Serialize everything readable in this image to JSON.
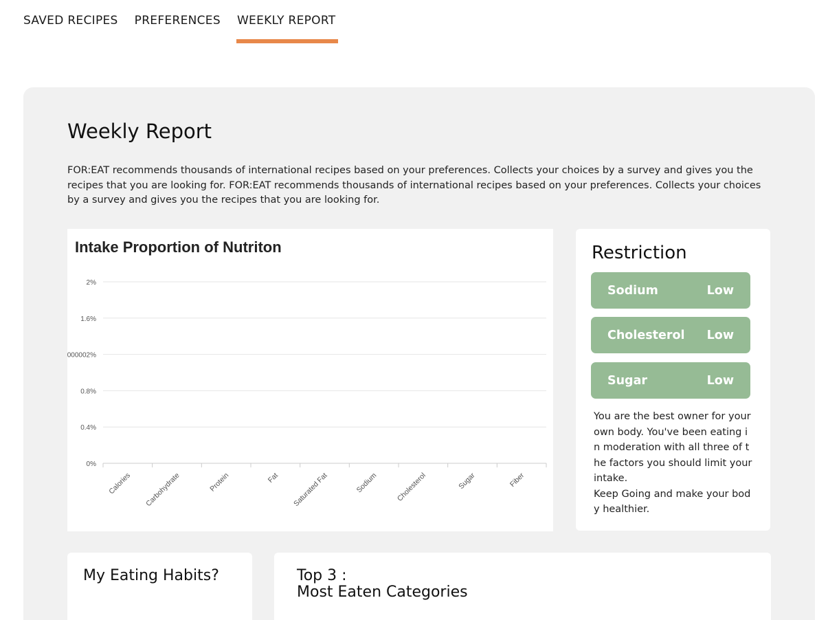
{
  "tabs": [
    {
      "label": "SAVED RECIPES",
      "active": false
    },
    {
      "label": "PREFERENCES",
      "active": false
    },
    {
      "label": "WEEKLY REPORT",
      "active": true
    }
  ],
  "colors": {
    "accent": "#e8884a",
    "pill": "#96bb95",
    "panel": "#f1f1f1"
  },
  "report": {
    "title": "Weekly Report",
    "description": "FOR:EAT recommends thousands of international recipes based on your preferences. Collects your choices by a survey and gives you the recipes that you are looking for. FOR:EAT recommends thousands of international recipes based on your preferences. Collects your choices by a survey and gives you the recipes that you are looking for."
  },
  "chart_data": {
    "type": "bar",
    "title": "Intake Proportion of Nutriton",
    "categories": [
      "Calories",
      "Carbohydrate",
      "Protein",
      "Fat",
      "Saturated Fat",
      "Sodium",
      "Cholesterol",
      "Sugar",
      "Fiber"
    ],
    "values": [
      0,
      0,
      0,
      0,
      0,
      0,
      0,
      0,
      0
    ],
    "y_ticks": [
      "0%",
      "0.4%",
      "0.8%",
      "000002%",
      "1.6%",
      "2%"
    ],
    "ylim": [
      0,
      2
    ],
    "grid": true
  },
  "restriction": {
    "title": "Restriction",
    "items": [
      {
        "name": "Sodium",
        "level": "Low"
      },
      {
        "name": "Cholesterol",
        "level": "Low"
      },
      {
        "name": "Sugar",
        "level": "Low"
      }
    ],
    "message": "You are the best owner for your own body. You've been eating in moderation with all three of the factors you should limit your intake.\nKeep Going and make your body healthier."
  },
  "habits": {
    "title": "My Eating Habits?"
  },
  "top3": {
    "title_line1": "Top 3 :",
    "title_line2": "Most Eaten Categories"
  }
}
